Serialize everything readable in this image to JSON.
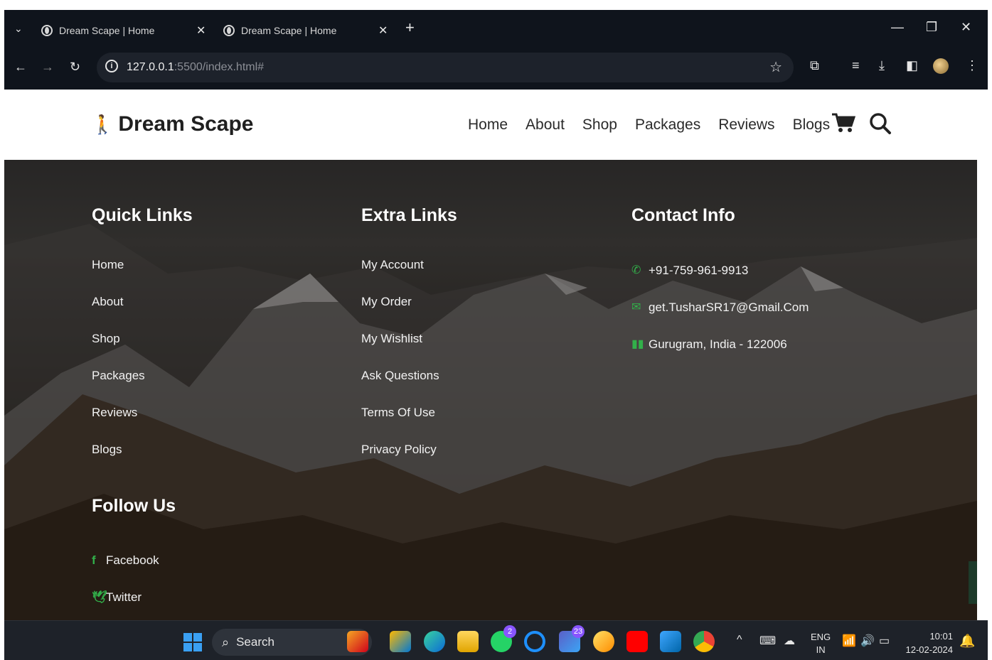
{
  "browser": {
    "tabs": [
      {
        "title": "Dream Scape | Home"
      },
      {
        "title": "Dream Scape | Home"
      }
    ],
    "url_host": "127.0.0.1",
    "url_rest": ":5500/index.html#"
  },
  "site": {
    "brand": "Dream Scape",
    "nav": [
      "Home",
      "About",
      "Shop",
      "Packages",
      "Reviews",
      "Blogs"
    ]
  },
  "footer": {
    "quick_links": {
      "title": "Quick Links",
      "items": [
        "Home",
        "About",
        "Shop",
        "Packages",
        "Reviews",
        "Blogs"
      ]
    },
    "extra_links": {
      "title": "Extra Links",
      "items": [
        "My Account",
        "My Order",
        "My Wishlist",
        "Ask Questions",
        "Terms Of Use",
        "Privacy Policy"
      ]
    },
    "contact_info": {
      "title": "Contact Info",
      "phone": "+91-759-961-9913",
      "email": "get.TusharSR17@Gmail.Com",
      "address": "Gurugram, India - 122006"
    },
    "follow_us": {
      "title": "Follow Us",
      "items": [
        "Facebook",
        "Twitter"
      ]
    }
  },
  "taskbar": {
    "search_label": "Search",
    "badges": {
      "whatsapp": "2",
      "teams": "23"
    },
    "lang_top": "ENG",
    "lang_bottom": "IN",
    "time": "10:01",
    "date": "12-02-2024"
  },
  "colors": {
    "accent_green": "#32b04a",
    "browser_dark": "#0f141c",
    "taskbar_dark": "#1e2229"
  }
}
